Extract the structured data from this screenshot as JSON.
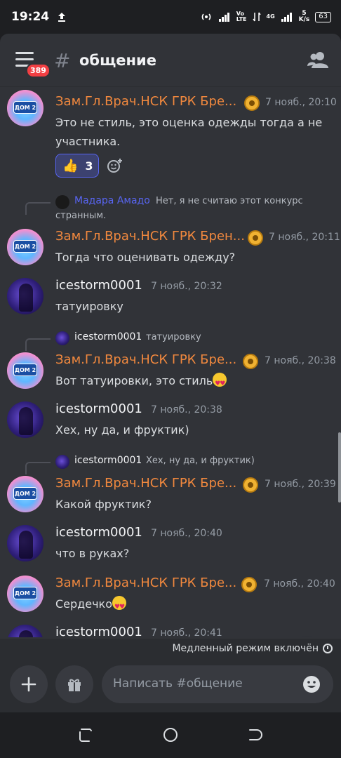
{
  "status": {
    "time": "19:24",
    "vo": "Vo",
    "lte": "LTE",
    "net": "4G",
    "speed_value": "5",
    "speed_unit": "K/s",
    "battery": "63"
  },
  "header": {
    "badge": "389",
    "hash": "#",
    "channel": "общение"
  },
  "messages": [
    {
      "author": "Зам.Гл.Врач.НСК ГРК Бре...",
      "time": "7 нояб., 20:10",
      "text1": "Это не стиль, это оценка одежды тогда а не",
      "text2": "участника.",
      "reaction_count": "3"
    },
    {
      "reply_author": "Мадара Амадо",
      "reply_text1": "Нет, я не считаю этот конкурс",
      "reply_text2": "странным.",
      "author": "Зам.Гл.Врач.НСК ГРК Брен...",
      "time": "7 нояб., 20:11",
      "text": "Тогда что оценивать одежду?"
    },
    {
      "author": "icestorm0001",
      "time": "7 нояб., 20:32",
      "text": "татуировку"
    },
    {
      "reply_author": "icestorm0001",
      "reply_text": "татуировку",
      "author": "Зам.Гл.Врач.НСК ГРК Бре...",
      "time": "7 нояб., 20:38",
      "text": "Вот татуировки, это стиль"
    },
    {
      "author": "icestorm0001",
      "time": "7 нояб., 20:38",
      "text": "Хех, ну да, и фруктик)"
    },
    {
      "reply_author": "icestorm0001",
      "reply_text": "Хех, ну да, и фруктик)",
      "author": "Зам.Гл.Врач.НСК ГРК Бре...",
      "time": "7 нояб., 20:39",
      "text": "Какой фруктик?"
    },
    {
      "author": "icestorm0001",
      "time": "7 нояб., 20:40",
      "text": "что в руках?"
    },
    {
      "author": "Зам.Гл.Врач.НСК ГРК Бре...",
      "time": "7 нояб., 20:40",
      "text": "Сердечко"
    },
    {
      "author": "icestorm0001",
      "time": "7 нояб., 20:41"
    }
  ],
  "avatar_logo": "ДОМ 2",
  "slowmode": "Медленный режим включён",
  "composer": {
    "placeholder": "Написать #общение"
  },
  "colors": {
    "background": "#313338",
    "accent": "#5865f2",
    "author_orange": "#f0883e",
    "reply_blue": "#5865f2",
    "badge_red": "#f23f43"
  },
  "icons": [
    "upload-icon",
    "hotspot-icon",
    "signal-icon",
    "battery-icon",
    "menu-icon",
    "members-icon",
    "crown-icon",
    "add-reaction-icon",
    "chevron-down-icon",
    "clock-icon",
    "plus-icon",
    "gift-icon",
    "smile-icon",
    "recents-icon",
    "home-icon",
    "back-icon"
  ]
}
